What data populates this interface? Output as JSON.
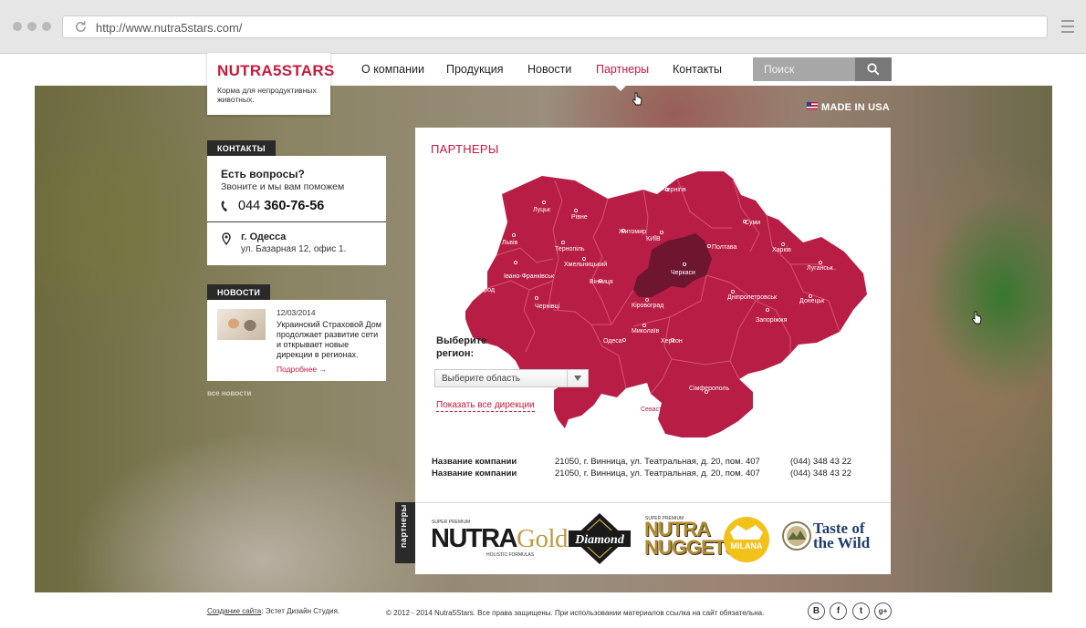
{
  "browser": {
    "url": "http://www.nutra5stars.com/"
  },
  "logo": {
    "name": "NUTRA5STARS",
    "tagline": "Корма для непродуктивных животных."
  },
  "nav": {
    "items": [
      {
        "label": "О компании"
      },
      {
        "label": "Продукция"
      },
      {
        "label": "Новости"
      },
      {
        "label": "Партнеры",
        "active": true
      },
      {
        "label": "Контакты"
      }
    ]
  },
  "search": {
    "placeholder": "Поиск"
  },
  "made_in": "MADE IN USA",
  "contacts": {
    "tag": "КОНТАКТЫ",
    "question": "Есть вопросы?",
    "subtitle": "Звоните и мы вам поможем",
    "phone_code": "044",
    "phone_number": "360-76-56",
    "city": "г. Одесса",
    "address": "ул. Базарная 12, офис 1."
  },
  "news": {
    "tag": "НОВОСТИ",
    "date": "12/03/2014",
    "text": "Украинский Страховой Дом продолжает развитие сети и открывает новые дирекции в регионах.",
    "more": "Подробнее →",
    "all": "все новости"
  },
  "partners": {
    "title": "ПАРТНЕРЫ",
    "choose_label_1": "Выберите",
    "choose_label_2": "регион:",
    "select_value": "Выберите область",
    "show_all": "Показать все дирекции",
    "regions": [
      "Чернігів",
      "Луцьк",
      "Рівне",
      "Суми",
      "Житомир",
      "КИЇВ",
      "Львів",
      "Тернопіль",
      "Полтава",
      "Харків",
      "Хмельницький",
      "Черкаси",
      "Луганськ",
      "Ужгород",
      "Івано-Франківськ",
      "Вінниця",
      "Дніпропетровськ",
      "Донецьк",
      "Чернівці",
      "Кіровоград",
      "Запоріжжя",
      "Миколаїв",
      "Одеса",
      "Херсон",
      "Сімферополь",
      "Севастополь"
    ],
    "companies": [
      {
        "name": "Название компании",
        "address": "21050, г. Винница, ул. Театральная, д. 20, пом. 407",
        "phone": "(044) 348 43 22"
      },
      {
        "name": "Название компании",
        "address": "21050, г. Винница, ул. Театральная, д. 20, пом. 407",
        "phone": "(044) 348 43 22"
      }
    ]
  },
  "brands": {
    "tag": "партнеры",
    "nutragold_top": "SUPER PREMIUM",
    "nutragold_a": "NUTRA",
    "nutragold_b": "Gold",
    "nutragold_sub": "HOLISTIC FORMULAS",
    "diamond": "Diamond",
    "nuggets_top": "SUPER PREMIUM",
    "nuggets_a": "NUTRA",
    "nuggets_b": "NUGGETS",
    "milana": "MILANA",
    "taste_a": "Taste of",
    "taste_b": "the Wild"
  },
  "footer": {
    "dev_link": "Создание сайта",
    "dev_rest": ": Эстет Дизайн Студия.",
    "copyright": "© 2012 - 2014 Nutra5Stars. Все права защищены. При использовании материалов ссылка на сайт обязательна.",
    "social": [
      "B",
      "f",
      "t",
      "g+"
    ]
  },
  "colors": {
    "brand": "#c8193c",
    "map_fill": "#b81e45",
    "map_highlight": "#6e1530",
    "dark": "#2a2a2a"
  }
}
